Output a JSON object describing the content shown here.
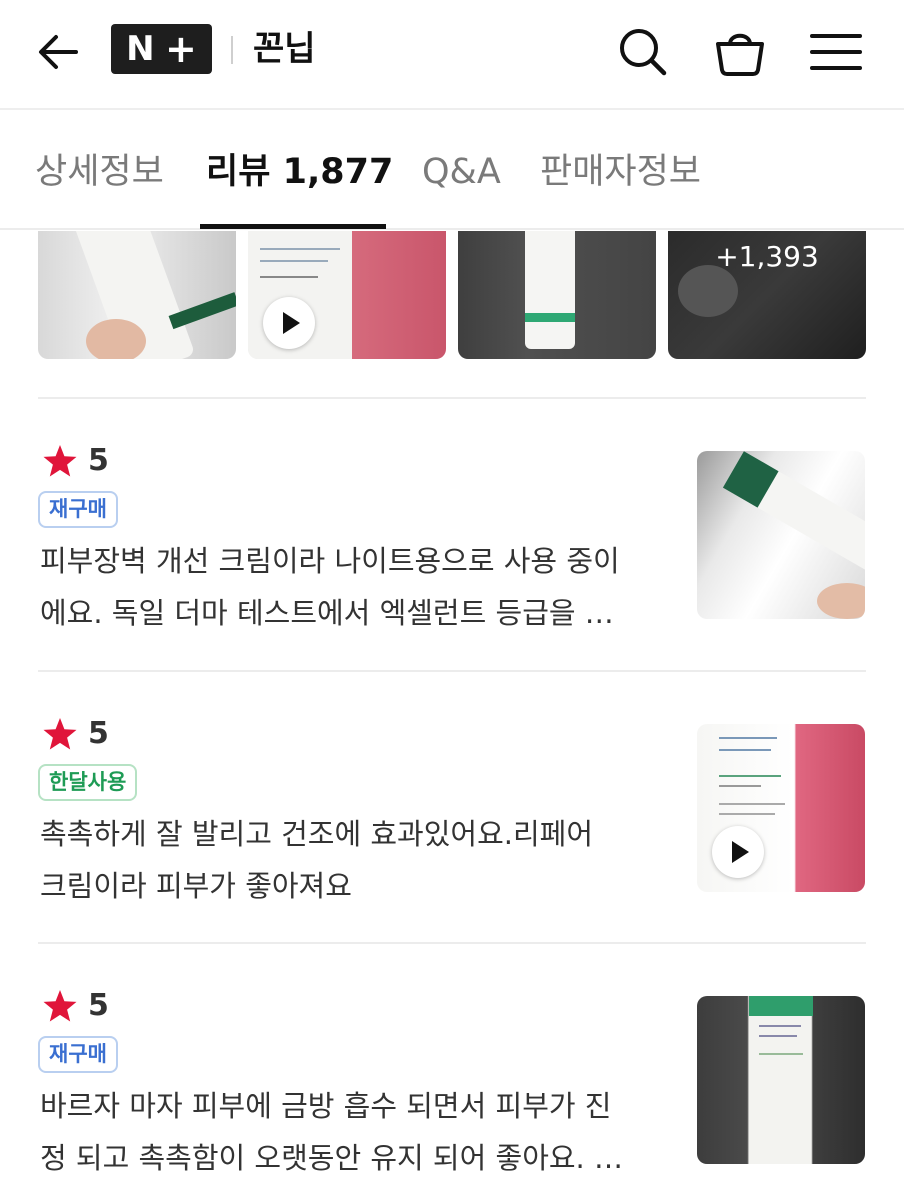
{
  "header": {
    "logo_n": "N",
    "logo_plus": "+",
    "store_name": "꼰닙"
  },
  "tabs": [
    {
      "label": "상세정보"
    },
    {
      "label": "리뷰 1,877"
    },
    {
      "label": "Q&A"
    },
    {
      "label": "판매자정보"
    }
  ],
  "photo_strip": {
    "more_count": "+1,393"
  },
  "reviews": [
    {
      "rating": "5",
      "badge": "재구매",
      "badge_color": "#3a6fd1",
      "line1": "피부장벽 개선 크림이라 나이트용으로 사용 중이",
      "line2": "에요. 독일 더마 테스트에서 엑셀런트 등급을 …"
    },
    {
      "rating": "5",
      "badge": "한달사용",
      "badge_color": "#1e9b55",
      "line1": "촉촉하게 잘 발리고 건조에 효과있어요.리페어",
      "line2": "크림이라 피부가 좋아져요"
    },
    {
      "rating": "5",
      "badge": "재구매",
      "badge_color": "#3a6fd1",
      "line1": "바르자 마자 피부에 금방 흡수 되면서 피부가 진",
      "line2": "정 되고 촉촉함이 오랫동안 유지 되어 좋아요. …"
    }
  ],
  "colors": {
    "star": "#e0153a",
    "accent_dark": "#111111"
  }
}
